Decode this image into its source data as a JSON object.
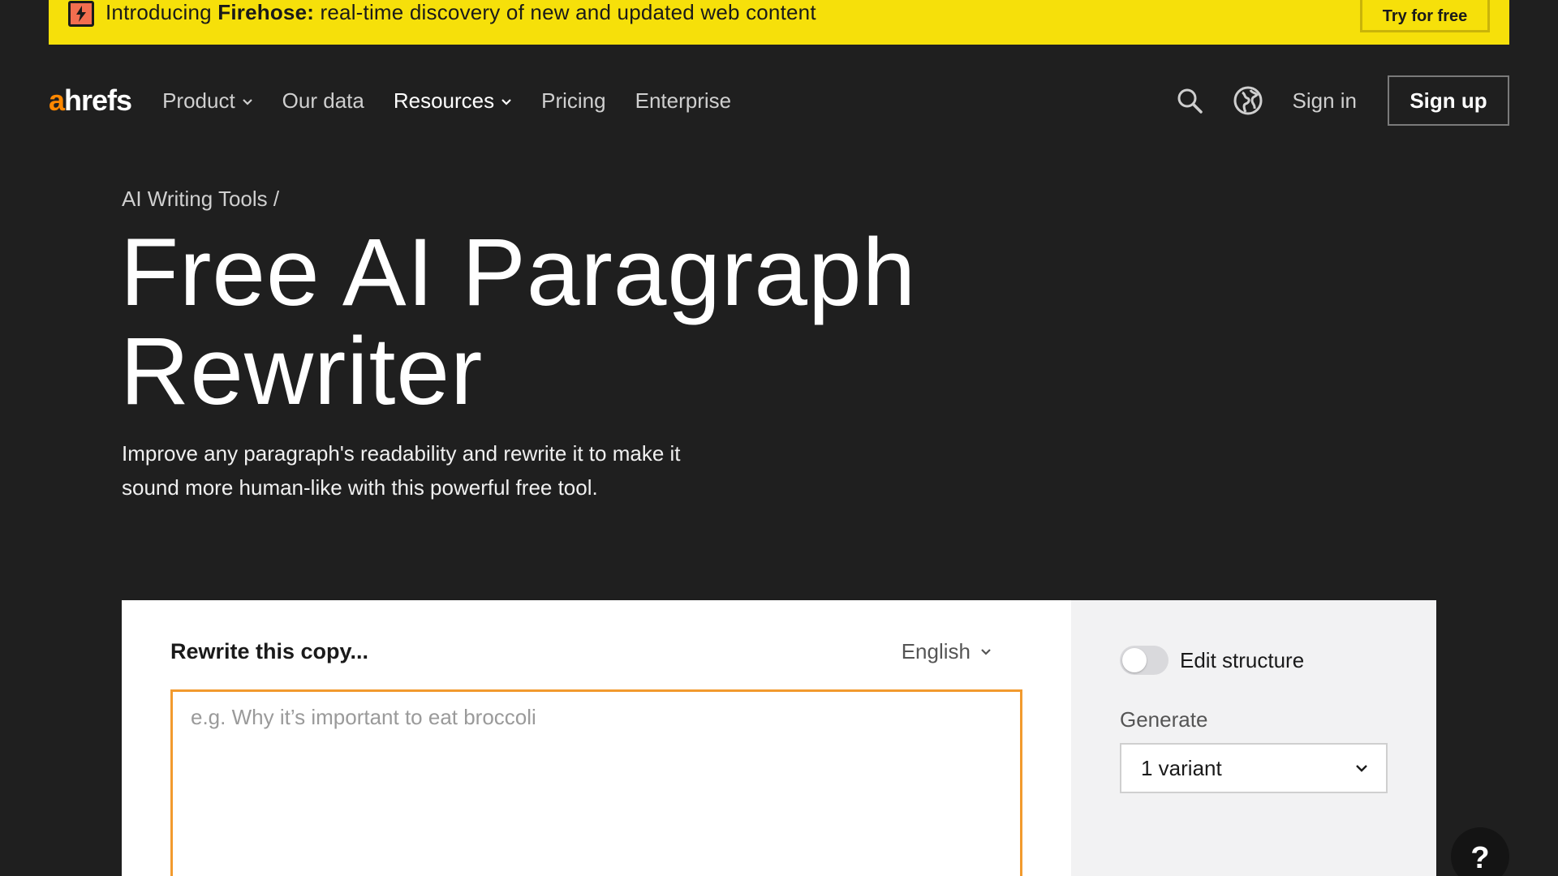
{
  "banner": {
    "intro": "Introducing ",
    "product_name": "Firehose:",
    "tagline": " real-time discovery of new and updated web content",
    "cta_label": "Try for free",
    "icon": "bolt-icon"
  },
  "nav": {
    "logo_accent": "a",
    "logo_rest": "hrefs",
    "items": [
      {
        "label": "Product",
        "has_dropdown": true
      },
      {
        "label": "Our data",
        "has_dropdown": false
      },
      {
        "label": "Resources",
        "has_dropdown": true
      },
      {
        "label": "Pricing",
        "has_dropdown": false
      },
      {
        "label": "Enterprise",
        "has_dropdown": false
      }
    ],
    "signin_label": "Sign in",
    "signup_label": "Sign up",
    "icons": [
      "search-icon",
      "globe-icon"
    ]
  },
  "hero": {
    "breadcrumb": "AI Writing Tools /",
    "title_line1": "Free AI Paragraph",
    "title_line2": "Rewriter",
    "subtitle": "Improve any paragraph's readability and rewrite it to make it sound more human-like with this powerful free tool."
  },
  "tool": {
    "heading": "Rewrite this copy...",
    "language": "English",
    "input_placeholder": "e.g. Why it’s important to eat broccoli",
    "input_value": "",
    "edit_structure_label": "Edit structure",
    "edit_structure_on": false,
    "generate_label": "Generate",
    "generate_value": "1 variant"
  },
  "help": {
    "label": "?"
  },
  "colors": {
    "background": "#1f1f1f",
    "banner": "#f6e00a",
    "accent_orange": "#ff8800",
    "input_border": "#f29a2e"
  }
}
